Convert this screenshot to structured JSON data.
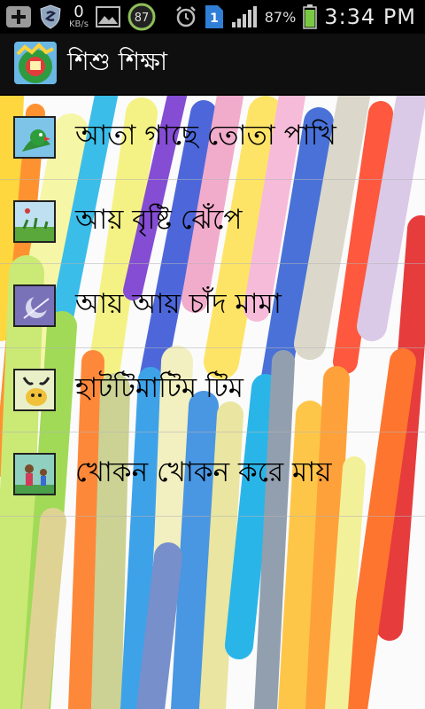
{
  "status_bar": {
    "network_speed": "0",
    "network_unit": "KB/s",
    "badge_number": "87",
    "sim_badge": "1",
    "battery_percent": "87%",
    "time": "3:34 PM",
    "icons": [
      "add-icon",
      "shield-icon",
      "image-icon",
      "badge-icon",
      "alarm-icon",
      "sim-icon",
      "signal-icon",
      "battery-icon"
    ]
  },
  "action_bar": {
    "title": "শিশু শিক্ষা",
    "logo_icon": "app-logo-icon"
  },
  "rhymes": [
    {
      "label": "আতা গাছে তোতা পাখি",
      "thumb_icon": "parrot-thumbnail"
    },
    {
      "label": "আয় বৃষ্টি ঝেঁপে",
      "thumb_icon": "rain-thumbnail"
    },
    {
      "label": "আয় আয় চাঁদ মামা",
      "thumb_icon": "moon-thumbnail"
    },
    {
      "label": "হাটটিমাটিম টিম",
      "thumb_icon": "creature-thumbnail"
    },
    {
      "label": "খোকন খোকন করে মায়",
      "thumb_icon": "mother-child-thumbnail"
    }
  ],
  "colors": {
    "status_bar_bg": "#000000",
    "action_bar_bg": "#0f0f0f",
    "battery_green": "#7ac943",
    "sim_blue": "#2f7fd6"
  }
}
